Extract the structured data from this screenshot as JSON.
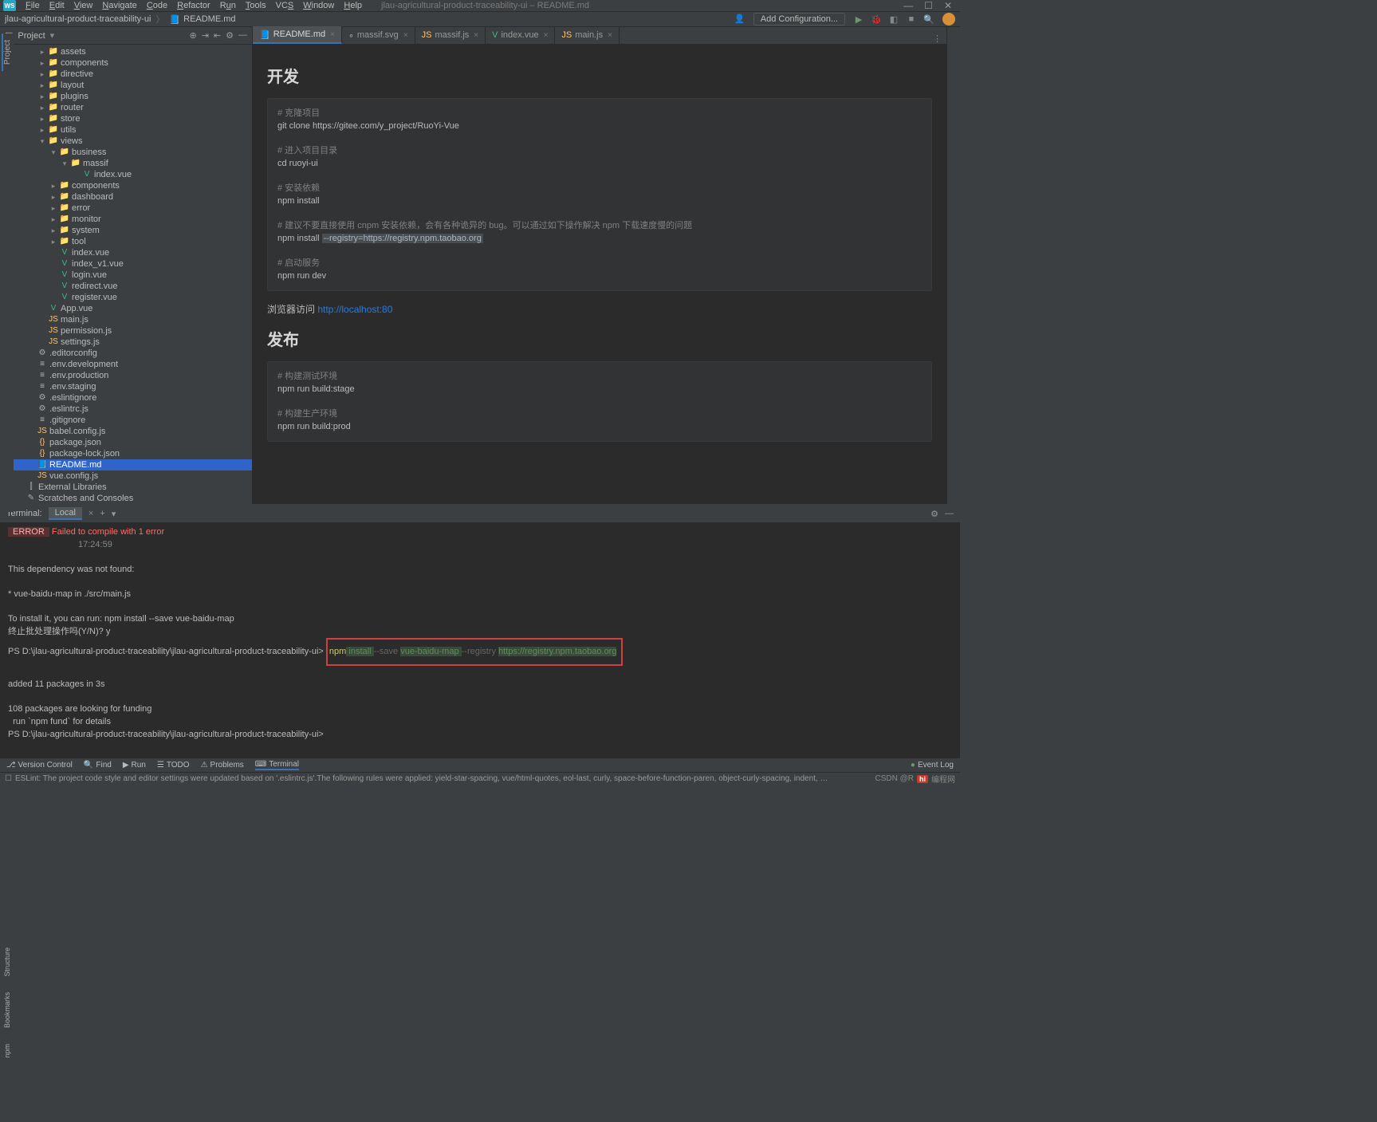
{
  "window": {
    "title": "jlau-agricultural-product-traceability-ui – README.md",
    "menus": [
      "File",
      "Edit",
      "View",
      "Navigate",
      "Code",
      "Refactor",
      "Run",
      "Tools",
      "VCS",
      "Window",
      "Help"
    ],
    "logo_text": "WS"
  },
  "breadcrumb": {
    "project": "jlau-agricultural-product-traceability-ui",
    "file": "README.md",
    "add_configuration": "Add Configuration..."
  },
  "project_panel": {
    "title": "Project",
    "tree": [
      {
        "d": 3,
        "a": ">",
        "i": "folder",
        "l": "assets"
      },
      {
        "d": 3,
        "a": ">",
        "i": "folder",
        "l": "components"
      },
      {
        "d": 3,
        "a": ">",
        "i": "folder",
        "l": "directive"
      },
      {
        "d": 3,
        "a": ">",
        "i": "folder",
        "l": "layout"
      },
      {
        "d": 3,
        "a": ">",
        "i": "folder",
        "l": "plugins"
      },
      {
        "d": 3,
        "a": ">",
        "i": "folder",
        "l": "router"
      },
      {
        "d": 3,
        "a": ">",
        "i": "folder",
        "l": "store"
      },
      {
        "d": 3,
        "a": ">",
        "i": "folder",
        "l": "utils"
      },
      {
        "d": 3,
        "a": "v",
        "i": "folder",
        "l": "views"
      },
      {
        "d": 4,
        "a": "v",
        "i": "folder",
        "l": "business"
      },
      {
        "d": 5,
        "a": "v",
        "i": "folder",
        "l": "massif"
      },
      {
        "d": 6,
        "a": "",
        "i": "vue",
        "l": "index.vue"
      },
      {
        "d": 4,
        "a": ">",
        "i": "folder",
        "l": "components"
      },
      {
        "d": 4,
        "a": ">",
        "i": "folder",
        "l": "dashboard"
      },
      {
        "d": 4,
        "a": ">",
        "i": "folder",
        "l": "error"
      },
      {
        "d": 4,
        "a": ">",
        "i": "folder",
        "l": "monitor"
      },
      {
        "d": 4,
        "a": ">",
        "i": "folder",
        "l": "system"
      },
      {
        "d": 4,
        "a": ">",
        "i": "folder",
        "l": "tool"
      },
      {
        "d": 4,
        "a": "",
        "i": "vue",
        "l": "index.vue"
      },
      {
        "d": 4,
        "a": "",
        "i": "vue",
        "l": "index_v1.vue"
      },
      {
        "d": 4,
        "a": "",
        "i": "vue",
        "l": "login.vue"
      },
      {
        "d": 4,
        "a": "",
        "i": "vue",
        "l": "redirect.vue"
      },
      {
        "d": 4,
        "a": "",
        "i": "vue",
        "l": "register.vue"
      },
      {
        "d": 3,
        "a": "",
        "i": "vue",
        "l": "App.vue"
      },
      {
        "d": 3,
        "a": "",
        "i": "js",
        "l": "main.js"
      },
      {
        "d": 3,
        "a": "",
        "i": "js",
        "l": "permission.js"
      },
      {
        "d": 3,
        "a": "",
        "i": "js",
        "l": "settings.js"
      },
      {
        "d": 2,
        "a": "",
        "i": "cfg",
        "l": ".editorconfig"
      },
      {
        "d": 2,
        "a": "",
        "i": "txt",
        "l": ".env.development"
      },
      {
        "d": 2,
        "a": "",
        "i": "txt",
        "l": ".env.production"
      },
      {
        "d": 2,
        "a": "",
        "i": "txt",
        "l": ".env.staging"
      },
      {
        "d": 2,
        "a": "",
        "i": "cfg",
        "l": ".eslintignore"
      },
      {
        "d": 2,
        "a": "",
        "i": "cfg",
        "l": ".eslintrc.js"
      },
      {
        "d": 2,
        "a": "",
        "i": "txt",
        "l": ".gitignore"
      },
      {
        "d": 2,
        "a": "",
        "i": "js",
        "l": "babel.config.js"
      },
      {
        "d": 2,
        "a": "",
        "i": "json",
        "l": "package.json"
      },
      {
        "d": 2,
        "a": "",
        "i": "json",
        "l": "package-lock.json"
      },
      {
        "d": 2,
        "a": "",
        "i": "md",
        "l": "README.md",
        "sel": true
      },
      {
        "d": 2,
        "a": "",
        "i": "js",
        "l": "vue.config.js"
      },
      {
        "d": 1,
        "a": "",
        "i": "lib",
        "l": "External Libraries"
      },
      {
        "d": 1,
        "a": "",
        "i": "scr",
        "l": "Scratches and Consoles"
      }
    ]
  },
  "left_strip": {
    "project": "Project",
    "structure": "Structure",
    "bookmarks": "Bookmarks",
    "npm": "npm"
  },
  "editor": {
    "tabs": [
      {
        "label": "README.md",
        "icon": "md",
        "active": true
      },
      {
        "label": "massif.svg",
        "icon": "svg"
      },
      {
        "label": "massif.js",
        "icon": "js"
      },
      {
        "label": "index.vue",
        "icon": "vue"
      },
      {
        "label": "main.js",
        "icon": "js"
      }
    ],
    "h_dev": "开发",
    "code1_c1": "# 克隆项目",
    "code1_l1": "git clone https://gitee.com/y_project/RuoYi-Vue",
    "code1_c2": "# 进入项目目录",
    "code1_l2": "cd ruoyi-ui",
    "code1_c3": "# 安装依赖",
    "code1_l3": "npm install",
    "code1_c4": "# 建议不要直接使用 cnpm 安装依赖，会有各种诡异的 bug。可以通过如下操作解决 npm 下载速度慢的问题",
    "code1_l4a": "npm install ",
    "code1_l4b": "--registry=https://registry.npm.taobao.org",
    "code1_c5": "# 启动服务",
    "code1_l5": "npm run dev",
    "browser_text": "浏览器访问 ",
    "browser_link": "http://localhost:80",
    "h_pub": "发布",
    "code2_c1": "# 构建测试环境",
    "code2_l1": "npm run build:stage",
    "code2_c2": "# 构建生产环境",
    "code2_l2": "npm run build:prod"
  },
  "terminal": {
    "title": "Terminal:",
    "tab": "Local",
    "err_label": " ERROR ",
    "err_msg": " Failed to compile with 1 error",
    "time": "17:24:59",
    "line_dep": "This dependency was not found:",
    "line_pkg": "* vue-baidu-map in ./src/main.js",
    "line_inst": "To install it, you can run: npm install --save vue-baidu-map",
    "line_stop": "终止批处理操作吗(Y/N)? y",
    "prompt1": "PS D:\\jlau-agricultural-product-traceability\\jlau-agricultural-product-traceability-ui> ",
    "cmd_npm": "npm",
    "cmd_install": " install ",
    "cmd_save": "--save ",
    "cmd_pkg": "vue-baidu-map ",
    "cmd_reg": "--registry ",
    "cmd_url": "https://registry.npm.taobao.org",
    "line_added": "added 11 packages in 3s",
    "line_fund1": "108 packages are looking for funding",
    "line_fund2": "  run `npm fund` for details",
    "prompt2": "PS D:\\jlau-agricultural-product-traceability\\jlau-agricultural-product-traceability-ui>"
  },
  "bottom_tools": {
    "version": "Version Control",
    "find": "Find",
    "run": "Run",
    "todo": "TODO",
    "problems": "Problems",
    "terminal": "Terminal",
    "eventlog": "Event Log"
  },
  "status": {
    "msg": "ESLint: The project code style and editor settings were updated based on '.eslintrc.js'.The following rules were applied: yield-star-spacing, vue/html-quotes, eol-last, curly, space-before-function-paren, object-curly-spacing, indent, vue/html-indent, no-trailin",
    "watermark_brand": "编程网",
    "csdn": "CSDN @R"
  }
}
